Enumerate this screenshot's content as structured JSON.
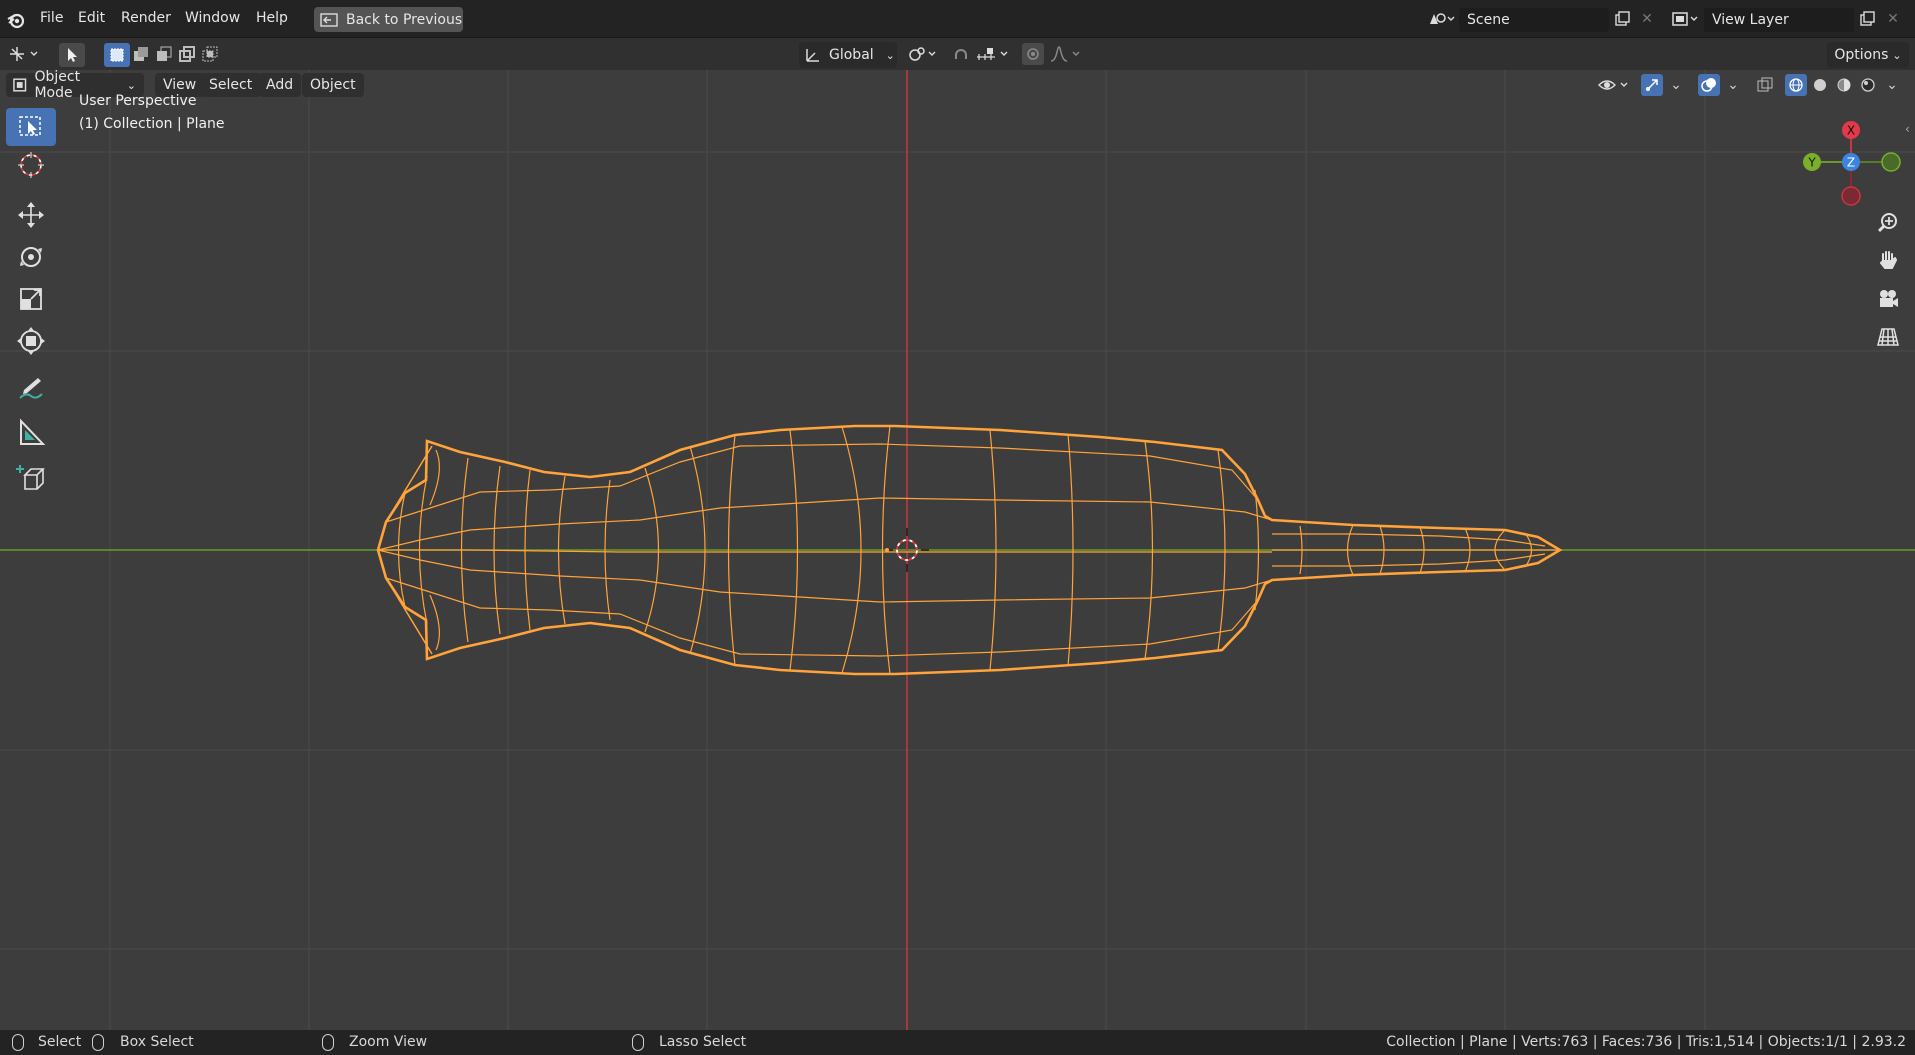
{
  "topbar": {
    "menu": [
      "File",
      "Edit",
      "Render",
      "Window",
      "Help"
    ],
    "back_button": "Back to Previous",
    "scene_field": "Scene",
    "view_layer_field": "View Layer"
  },
  "toolheader": {
    "orientation": "Global",
    "options": "Options"
  },
  "viewport_header": {
    "mode": "Object Mode",
    "menus": [
      "View",
      "Select",
      "Add",
      "Object"
    ]
  },
  "viewport": {
    "perspective_label": "User Perspective",
    "collection_label": "(1) Collection | Plane",
    "gizmo": {
      "x": "X",
      "y": "Y",
      "z": "Z"
    },
    "colors": {
      "background": "#3d3d3d",
      "grid": "#4a4a4a",
      "x_axis": "#c9363f",
      "y_axis": "#6a9a2a",
      "wire_selected": "#ffa33a",
      "active_tool": "#4772b3"
    }
  },
  "toolbar": {
    "tools": [
      "select-box-icon",
      "cursor-icon",
      "move-icon",
      "rotate-icon",
      "scale-icon",
      "transform-icon",
      "annotate-icon",
      "measure-icon",
      "add-cube-icon"
    ]
  },
  "statusbar": {
    "select": "Select",
    "box_select": "Box Select",
    "zoom_view": "Zoom View",
    "lasso_select": "Lasso Select",
    "stats": "Collection | Plane | Verts:763 | Faces:736 | Tris:1,514 | Objects:1/1 | 2.93.2"
  }
}
